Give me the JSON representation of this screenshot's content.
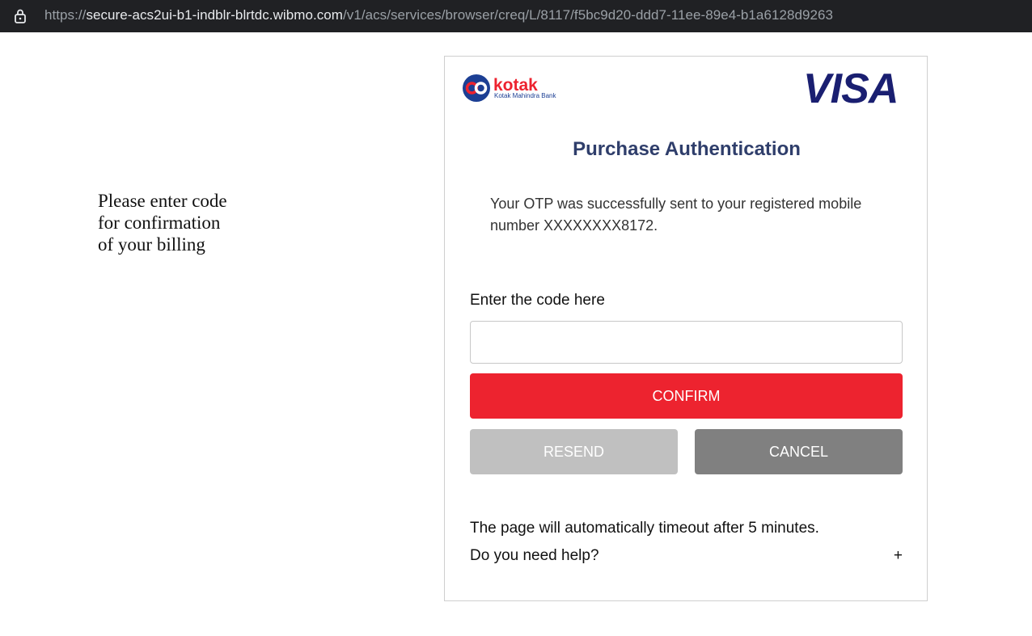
{
  "browser": {
    "url_prefix": "https://",
    "url_host": "secure-acs2ui-b1-indblr-blrtdc.wibmo.com",
    "url_path": "/v1/acs/services/browser/creq/L/8117/f5bc9d20-ddd7-11ee-89e4-b1a6128d9263"
  },
  "left_message": {
    "line1": "Please enter code",
    "line2": "for confirmation",
    "line3": "of your billing"
  },
  "header": {
    "bank_name": "kotak",
    "bank_tagline": "Kotak Mahindra Bank",
    "network": "VISA"
  },
  "main": {
    "title": "Purchase Authentication",
    "otp_message": "Your OTP was successfully sent to your registered mobile number XXXXXXXX8172.",
    "code_label": "Enter the code here",
    "code_value": "",
    "confirm_label": "CONFIRM",
    "resend_label": "RESEND",
    "cancel_label": "CANCEL",
    "timeout_text": "The page will automatically timeout after 5 minutes.",
    "help_text": "Do you need help?",
    "help_toggle": "+"
  },
  "colors": {
    "confirm": "#ed232f",
    "resend_disabled": "#c0c0c0",
    "cancel": "#808080",
    "title": "#2f3e6b",
    "visa": "#1a1f71"
  }
}
